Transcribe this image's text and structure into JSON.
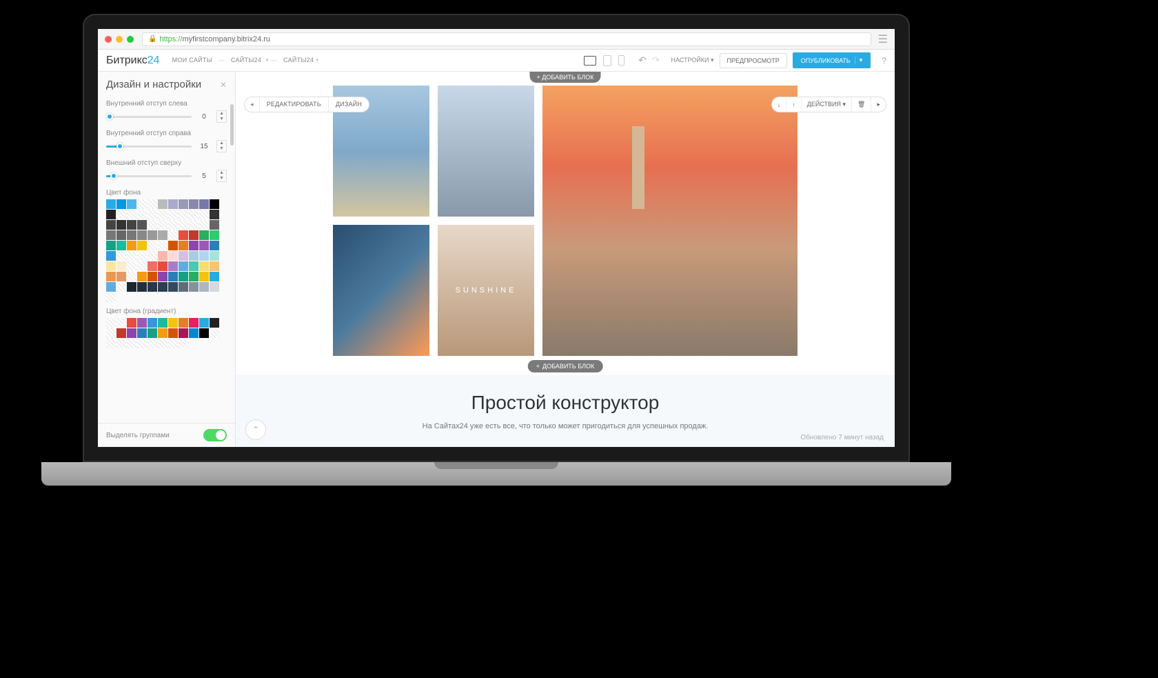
{
  "url": {
    "proto": "https://",
    "host": "myfirstcompany.bitrix24.ru"
  },
  "logo": {
    "part1": "Битрикс",
    "part2": "24"
  },
  "breadcrumb": {
    "item1": "МОИ САЙТЫ",
    "item2": "САЙТЫ24",
    "item3": "САЙТЫ24"
  },
  "topbar": {
    "settings": "НАСТРОЙКИ",
    "preview": "ПРЕДПРОСМОТР",
    "publish": "ОПУБЛИКОВАТЬ",
    "help": "?"
  },
  "sidebar": {
    "title": "Дизайн и настройки",
    "padding_left": {
      "label": "Внутренний отступ слева",
      "value": "0"
    },
    "padding_right": {
      "label": "Внутренний отступ справа",
      "value": "15"
    },
    "margin_top": {
      "label": "Внешний отступ сверху",
      "value": "5"
    },
    "bg_label": "Цвет фона",
    "gradient_label": "Цвет фона (градиент)",
    "footer": {
      "label": "Выделять группами"
    }
  },
  "canvas": {
    "add_top": "+ ДОБАВИТЬ БЛОК",
    "toolbar": {
      "edit": "РЕДАКТИРОВАТЬ",
      "design": "ДИЗАЙН",
      "actions": "ДЕЙСТВИЯ"
    },
    "img4_text": "SUNSHINE",
    "add_bottom": "ДОБАВИТЬ БЛОК",
    "constructor_title": "Простой конструктор",
    "constructor_sub": "На Сайтах24 уже есть все, что только может пригодиться для успешных продаж.",
    "updated": "Обновлено 7 минут назад"
  },
  "colors": {
    "row1": [
      "#29abe2",
      "#0099e5",
      "#4db8e8",
      "#fff",
      "#fff",
      "#bbb",
      "#aac",
      "#99b",
      "#88a",
      "#77a"
    ],
    "row2": [
      "#000",
      "#222",
      "#fff",
      "#fff",
      "#fff",
      "#fff",
      "#fff",
      "#fff",
      "#fff",
      "#fff"
    ],
    "row3": [
      "#fff",
      "#333",
      "#444",
      "#333",
      "#444",
      "#555",
      "#fff",
      "#fff",
      "#fff",
      "#fff"
    ],
    "row4": [
      "#fff",
      "#fff",
      "#666",
      "#777",
      "#666",
      "#777",
      "#888",
      "#999",
      "#aaa",
      "#fff"
    ],
    "row5": [
      "#e74c3c",
      "#c0392b",
      "#27ae60",
      "#2ecc71",
      "#16a085",
      "#1abc9c",
      "#f39c12",
      "#f1c40f",
      "#fff",
      "#fff"
    ],
    "row6": [
      "#d35400",
      "#e67e22",
      "#8e44ad",
      "#9b59b6",
      "#2980b9",
      "#3498db",
      "#fff",
      "#fff",
      "#fff",
      "#fff"
    ],
    "row7": [
      "#f5b7b1",
      "#fadbd8",
      "#d7bde2",
      "#a9cce3",
      "#aed6f1",
      "#a3e4d7",
      "#f9e79f",
      "#fdebd0",
      "#fff",
      "#fff"
    ],
    "row8": [
      "#ec7063",
      "#e74c3c",
      "#af7ac5",
      "#5dade2",
      "#48c9b0",
      "#f7dc6f",
      "#f8c471",
      "#eb984e",
      "#e59866",
      "#fff"
    ],
    "row9": [
      "#f39c12",
      "#d35400",
      "#8e44ad",
      "#2980b9",
      "#16a085",
      "#27ae60",
      "#f1c40f",
      "#29abe2",
      "#5dade2",
      "#fff"
    ],
    "row10": [
      "#1b2631",
      "#212f3c",
      "#283747",
      "#2c3e50",
      "#34495e",
      "#5d6d7e",
      "#85929e",
      "#aeb6bf",
      "#d5d8dc",
      "#fff"
    ],
    "grad1": [
      "#fff",
      "#fff",
      "#e74c3c",
      "#9b59b6",
      "#3498db",
      "#1abc9c",
      "#f1c40f",
      "#e67e22",
      "#e91e63",
      "#29abe2"
    ],
    "grad2": [
      "#222",
      "#fff",
      "#c0392b",
      "#8e44ad",
      "#2980b9",
      "#16a085",
      "#f39c12",
      "#d35400",
      "#ad1457",
      "#0288d1"
    ],
    "grad3": [
      "#000",
      "#fff",
      "#fff",
      "#fff",
      "#fff",
      "#fff",
      "#fff",
      "#fff",
      "#fff",
      "#fff"
    ]
  }
}
